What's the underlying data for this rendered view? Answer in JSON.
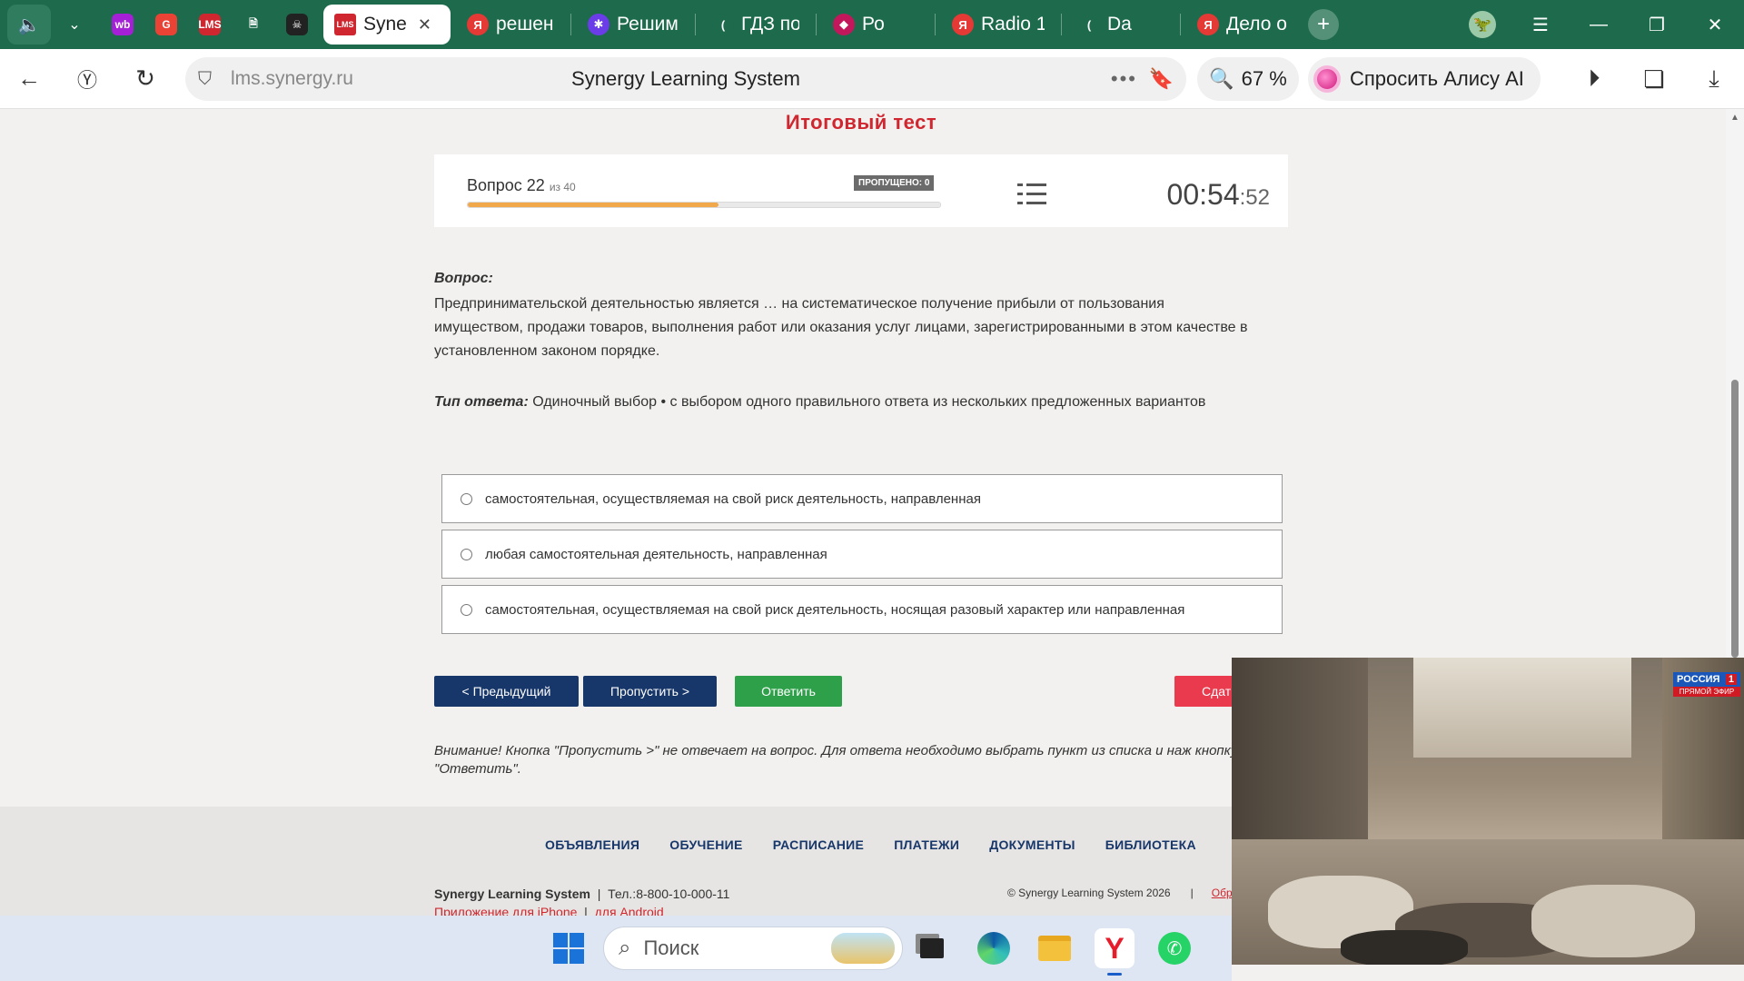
{
  "browser": {
    "tabs": [
      {
        "label": "Syne",
        "icon": "LMS",
        "active": true,
        "color": "#d0262f"
      },
      {
        "label": "решени",
        "icon": "Я",
        "color": "#e53935"
      },
      {
        "label": "Решим",
        "icon": "✱",
        "color": "#6a3de8"
      },
      {
        "label": "ГДЗ по",
        "icon": "(",
        "color": "#1d6b4c"
      },
      {
        "label": "Ро",
        "icon": "◆",
        "color": "#c2185b"
      },
      {
        "label": "Radio 1",
        "icon": "Я",
        "color": "#e53935"
      },
      {
        "label": "Da",
        "icon": "(",
        "color": "#1d6b4c"
      },
      {
        "label": "Дело о",
        "icon": "Я",
        "color": "#e53935"
      }
    ],
    "pinned": [
      {
        "name": "wildberries-icon",
        "text": "wb",
        "color": "#a51fd6"
      },
      {
        "name": "google-icon",
        "text": "G",
        "color": "#ea4335"
      },
      {
        "name": "lms-icon",
        "text": "LMS",
        "color": "#d0262f"
      },
      {
        "name": "document-icon",
        "text": "🗎",
        "color": "#1d6b4c"
      },
      {
        "name": "game-icon",
        "text": "☠",
        "color": "#222"
      }
    ],
    "address": {
      "domain": "lms.synergy.ru",
      "page_title": "Synergy Learning System",
      "zoom": "67 %",
      "alice_label": "Спросить Алису AI"
    }
  },
  "test": {
    "title": "Итоговый тест",
    "question_label": "Вопрос 22",
    "question_of": "из 40",
    "skipped": "ПРОПУЩЕНО: 0",
    "progress": 0.53,
    "timer_main": "00:54",
    "timer_sec": ":52",
    "q_header": "Вопрос:",
    "q_text": "Предпринимательской деятельностью является … на систематическое получение прибыли от пользования имуществом, продажи товаров, выполнения работ или оказания услуг лицами, зарегистрированными в этом качестве в установленном законом порядке.",
    "answer_type_label": "Тип ответа:",
    "answer_type_text": "Одиночный выбор • с выбором одного правильного ответа из нескольких предложенных вариантов",
    "options": [
      "самостоятельная, осуществляемая на свой риск деятельность, направленная",
      "любая самостоятельная деятельность, направленная",
      "самостоятельная, осуществляемая на свой риск деятельность, носящая разовый характер или направленная"
    ],
    "buttons": {
      "prev": "< Предыдущий",
      "skip": "Пропустить >",
      "answer": "Ответить",
      "finish": "Сдат"
    },
    "notice": "Внимание! Кнопка \"Пропустить >\" не отвечает на вопрос. Для ответа необходимо выбрать пункт из списка и наж кнопку \"Ответить\"."
  },
  "footer": {
    "nav": [
      "ОБЪЯВЛЕНИЯ",
      "ОБУЧЕНИЕ",
      "РАСПИСАНИЕ",
      "ПЛАТЕЖИ",
      "ДОКУМЕНТЫ",
      "БИБЛИОТЕКА"
    ],
    "brand": "Synergy Learning System",
    "phone": "Тел.:8-800-10-000-11",
    "iphone_link": "Приложение для iPhone",
    "android_link": "для Android",
    "copyright": "© Synergy Learning System 2026",
    "obr": "Обр"
  },
  "video": {
    "channel": "РОССИЯ",
    "channel_num": "1",
    "live": "ПРЯМОЙ ЭФИР"
  },
  "taskbar": {
    "search_placeholder": "Поиск"
  }
}
